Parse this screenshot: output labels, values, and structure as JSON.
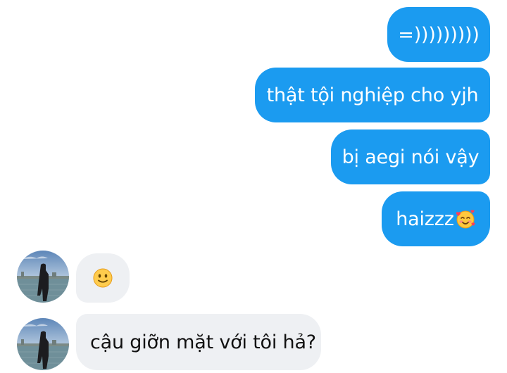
{
  "conversation": {
    "outgoing": [
      {
        "text": "=)))))))))"
      },
      {
        "text": "thật tội nghiệp cho yjh"
      },
      {
        "text": "bị aegi nói vậy"
      },
      {
        "text": "haizzz",
        "emoji": "smiling-face-with-hearts-icon"
      }
    ],
    "incoming": [
      {
        "emoji": "slightly-smiling-face-icon"
      },
      {
        "text": "cậu giỡn mặt với tôi hả?"
      }
    ]
  },
  "colors": {
    "outgoing_bubble": "#1b9bf0",
    "incoming_bubble": "#eef0f3",
    "background": "#ffffff"
  }
}
